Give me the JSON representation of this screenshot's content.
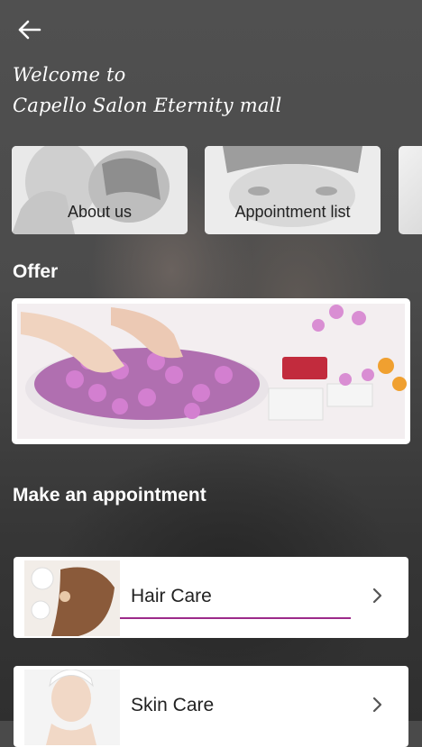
{
  "header": {
    "title_line1": "Welcome to",
    "title_line2": "Capello Salon Eternity mall"
  },
  "cards": [
    {
      "label": "About us"
    },
    {
      "label": "Appointment list"
    }
  ],
  "offer": {
    "section_title": "Offer"
  },
  "appointment": {
    "section_title": "Make an appointment",
    "services": [
      {
        "label": "Hair Care"
      },
      {
        "label": "Skin Care"
      }
    ]
  },
  "colors": {
    "accent_underline": "#9c2a8a"
  },
  "icons": {
    "back": "arrow-left-icon",
    "chevron": "chevron-right-icon"
  }
}
